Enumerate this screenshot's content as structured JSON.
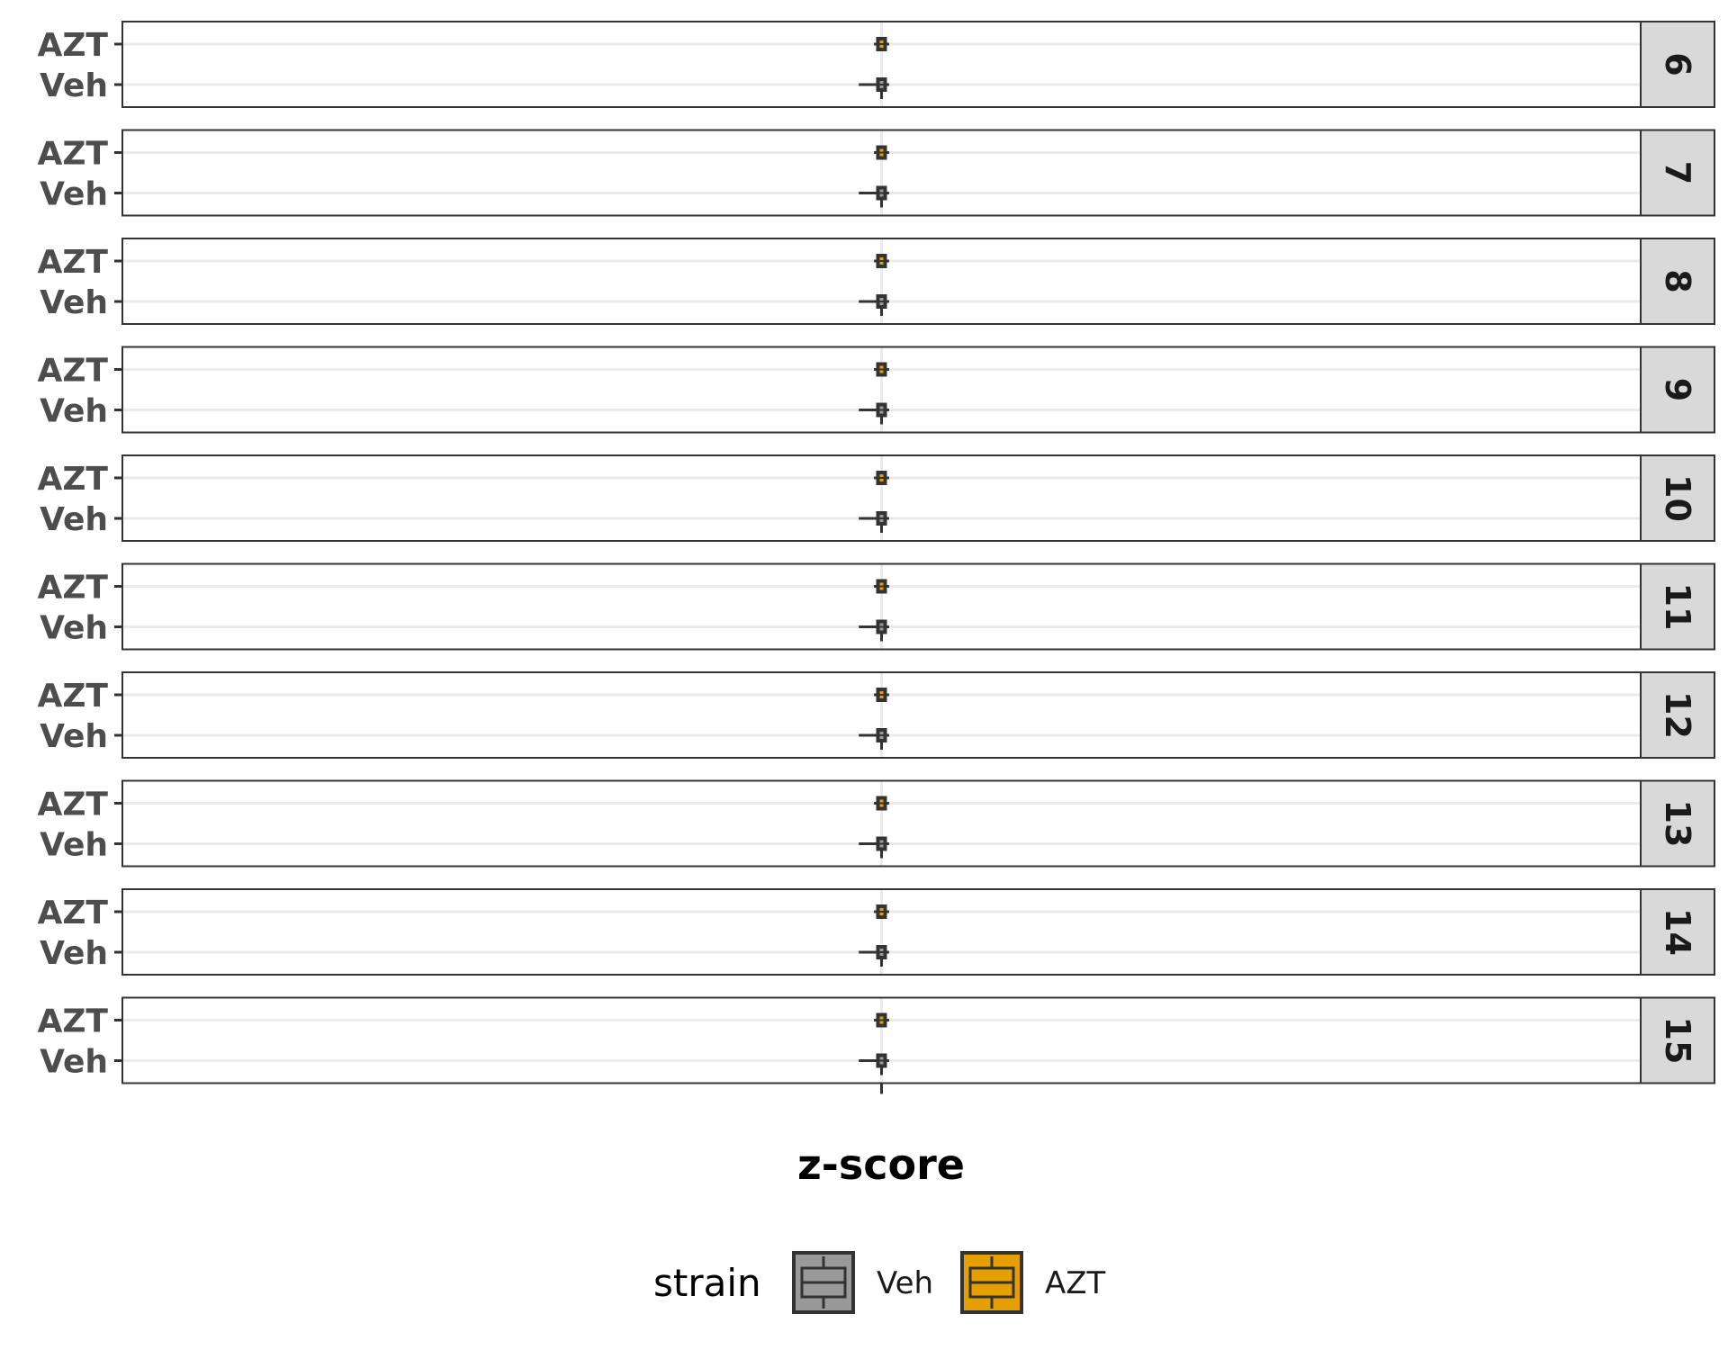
{
  "chart_data": {
    "type": "boxplot",
    "orientation": "horizontal",
    "facet_by": "row",
    "facets": [
      "6",
      "7",
      "8",
      "9",
      "10",
      "11",
      "12",
      "13",
      "14",
      "15"
    ],
    "categories": [
      "AZT",
      "Veh"
    ],
    "xlabel": "z-score",
    "xlim": [
      -1,
      1
    ],
    "legend": {
      "title": "strain",
      "placement": "bottom",
      "entries": [
        {
          "label": "Veh",
          "color": "#999999"
        },
        {
          "label": "AZT",
          "color": "#E69F00"
        }
      ]
    },
    "grid": true,
    "series": [
      {
        "facet": "6",
        "strain": "AZT",
        "median": 0,
        "q1": -0.005,
        "q3": 0.005,
        "whisker_low": -0.01,
        "whisker_high": 0.01
      },
      {
        "facet": "6",
        "strain": "Veh",
        "median": 0,
        "q1": -0.005,
        "q3": 0.005,
        "whisker_low": -0.03,
        "whisker_high": 0.01
      },
      {
        "facet": "7",
        "strain": "AZT",
        "median": 0,
        "q1": -0.005,
        "q3": 0.005,
        "whisker_low": -0.01,
        "whisker_high": 0.01
      },
      {
        "facet": "7",
        "strain": "Veh",
        "median": 0,
        "q1": -0.005,
        "q3": 0.005,
        "whisker_low": -0.03,
        "whisker_high": 0.01
      },
      {
        "facet": "8",
        "strain": "AZT",
        "median": 0,
        "q1": -0.005,
        "q3": 0.005,
        "whisker_low": -0.01,
        "whisker_high": 0.01
      },
      {
        "facet": "8",
        "strain": "Veh",
        "median": 0,
        "q1": -0.005,
        "q3": 0.005,
        "whisker_low": -0.03,
        "whisker_high": 0.01
      },
      {
        "facet": "9",
        "strain": "AZT",
        "median": 0,
        "q1": -0.005,
        "q3": 0.005,
        "whisker_low": -0.01,
        "whisker_high": 0.01
      },
      {
        "facet": "9",
        "strain": "Veh",
        "median": 0,
        "q1": -0.005,
        "q3": 0.005,
        "whisker_low": -0.03,
        "whisker_high": 0.01
      },
      {
        "facet": "10",
        "strain": "AZT",
        "median": 0,
        "q1": -0.005,
        "q3": 0.005,
        "whisker_low": -0.01,
        "whisker_high": 0.01
      },
      {
        "facet": "10",
        "strain": "Veh",
        "median": 0,
        "q1": -0.005,
        "q3": 0.005,
        "whisker_low": -0.03,
        "whisker_high": 0.01
      },
      {
        "facet": "11",
        "strain": "AZT",
        "median": 0,
        "q1": -0.005,
        "q3": 0.005,
        "whisker_low": -0.01,
        "whisker_high": 0.01
      },
      {
        "facet": "11",
        "strain": "Veh",
        "median": 0,
        "q1": -0.005,
        "q3": 0.005,
        "whisker_low": -0.03,
        "whisker_high": 0.01
      },
      {
        "facet": "12",
        "strain": "AZT",
        "median": 0,
        "q1": -0.005,
        "q3": 0.005,
        "whisker_low": -0.01,
        "whisker_high": 0.01
      },
      {
        "facet": "12",
        "strain": "Veh",
        "median": 0,
        "q1": -0.005,
        "q3": 0.005,
        "whisker_low": -0.03,
        "whisker_high": 0.01
      },
      {
        "facet": "13",
        "strain": "AZT",
        "median": 0,
        "q1": -0.005,
        "q3": 0.005,
        "whisker_low": -0.01,
        "whisker_high": 0.01
      },
      {
        "facet": "13",
        "strain": "Veh",
        "median": 0,
        "q1": -0.005,
        "q3": 0.005,
        "whisker_low": -0.03,
        "whisker_high": 0.01
      },
      {
        "facet": "14",
        "strain": "AZT",
        "median": 0,
        "q1": -0.005,
        "q3": 0.005,
        "whisker_low": -0.01,
        "whisker_high": 0.01
      },
      {
        "facet": "14",
        "strain": "Veh",
        "median": 0,
        "q1": -0.005,
        "q3": 0.005,
        "whisker_low": -0.03,
        "whisker_high": 0.01
      },
      {
        "facet": "15",
        "strain": "AZT",
        "median": 0,
        "q1": -0.005,
        "q3": 0.005,
        "whisker_low": -0.01,
        "whisker_high": 0.01
      },
      {
        "facet": "15",
        "strain": "Veh",
        "median": 0,
        "q1": -0.005,
        "q3": 0.005,
        "whisker_low": -0.03,
        "whisker_high": 0.01
      }
    ]
  }
}
